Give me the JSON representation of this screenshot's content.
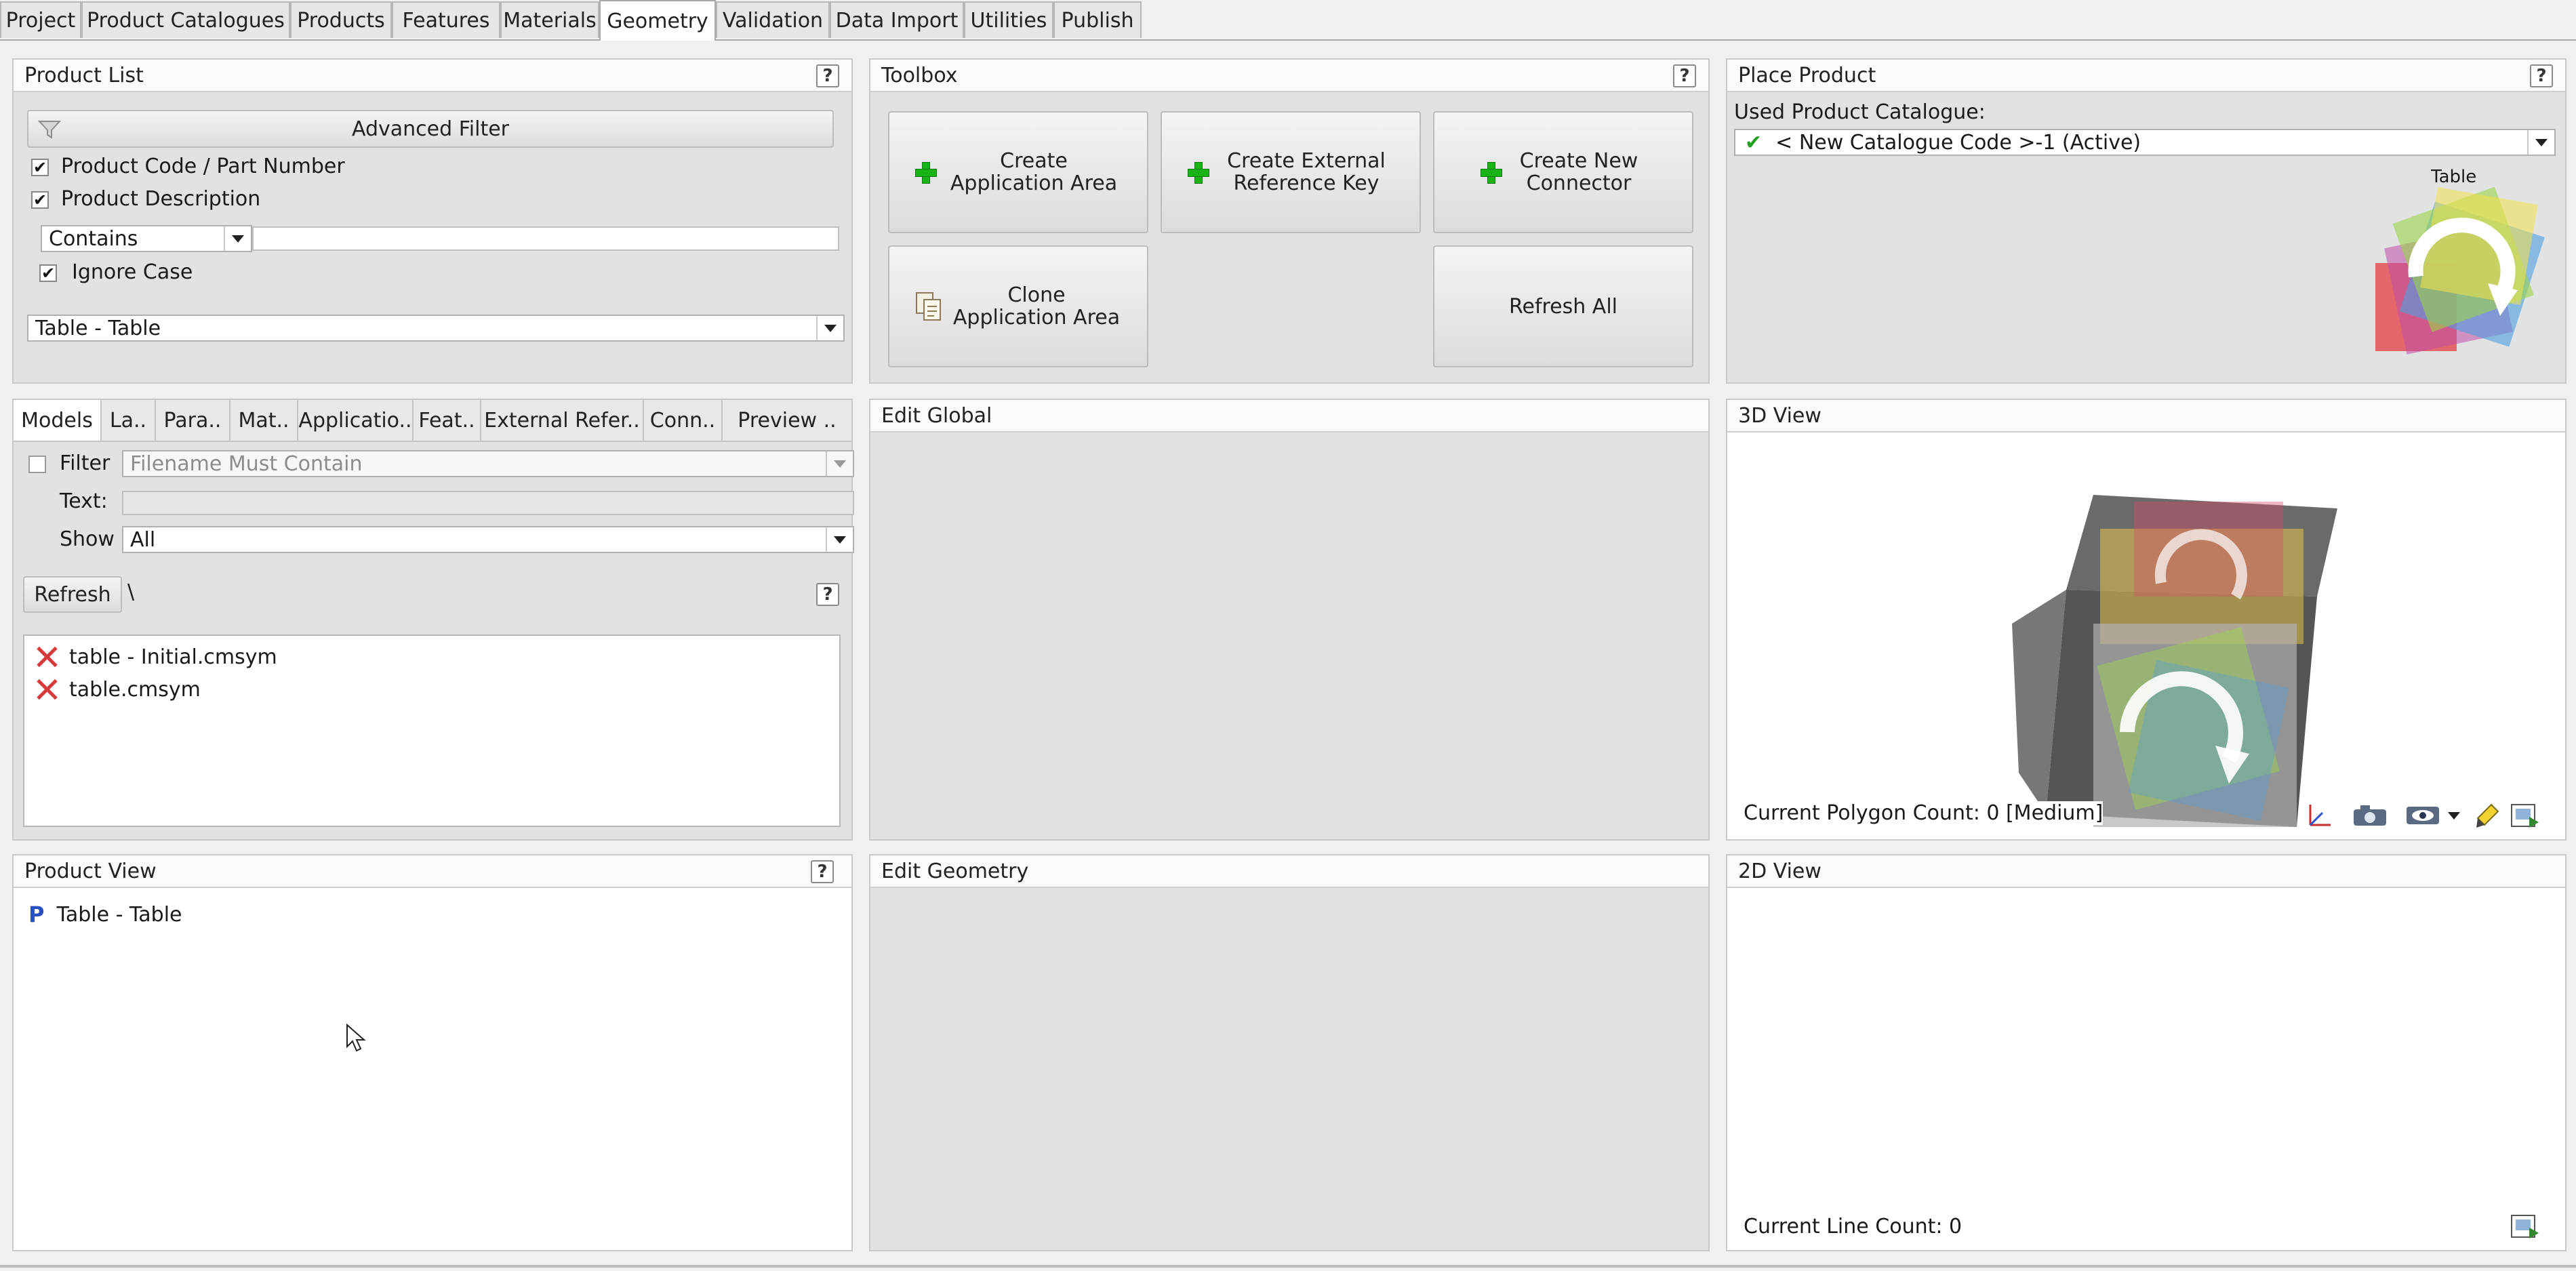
{
  "tabs": [
    {
      "label": "Project",
      "active": false
    },
    {
      "label": "Product Catalogues",
      "active": false
    },
    {
      "label": "Products",
      "active": false
    },
    {
      "label": "Features",
      "active": false
    },
    {
      "label": "Materials",
      "active": false
    },
    {
      "label": "Geometry",
      "active": true
    },
    {
      "label": "Validation",
      "active": false
    },
    {
      "label": "Data Import",
      "active": false
    },
    {
      "label": "Utilities",
      "active": false
    },
    {
      "label": "Publish",
      "active": false
    }
  ],
  "product_list": {
    "title": "Product List",
    "help": "?",
    "advanced_filter": "Advanced Filter",
    "checks": [
      {
        "label": "Product Code / Part Number",
        "checked": true
      },
      {
        "label": "Product Description",
        "checked": true
      }
    ],
    "match_mode": "Contains",
    "search_value": "",
    "ignore_case": {
      "label": "Ignore Case",
      "checked": true
    },
    "product_select": "Table - Table"
  },
  "toolbox": {
    "title": "Toolbox",
    "help": "?",
    "buttons": {
      "create_app_area": "Create Application Area",
      "create_ext_ref": "Create External Reference Key",
      "create_connector": "Create New Connector",
      "clone_app_area": "Clone Application Area",
      "refresh_all": "Refresh All"
    }
  },
  "place_product": {
    "title": "Place Product",
    "help": "?",
    "used_catalogue_label": "Used Product Catalogue:",
    "catalogue_value": "< New Catalogue Code >-1 (Active)",
    "thumbnail_label": "Table"
  },
  "models": {
    "subtabs": [
      "Models",
      "La..",
      "Para..",
      "Mat..",
      "Applicatio..",
      "Feat..",
      "External Refer..",
      "Conn..",
      "Preview .."
    ],
    "filter_label": "Filter",
    "filter_checked": false,
    "filter_placeholder": "Filename Must Contain",
    "text_label": "Text:",
    "show_label": "Show",
    "show_value": "All",
    "refresh": "Refresh",
    "path": "\\",
    "help": "?",
    "files": [
      "table - Initial.cmsym",
      "table.cmsym"
    ]
  },
  "edit_global": {
    "title": "Edit Global"
  },
  "view3d": {
    "title": "3D View",
    "polygon_count": "Current Polygon Count: 0 [Medium]",
    "toolbar_icons": [
      "axes-icon",
      "camera-icon",
      "eye-icon",
      "dropdown-arrow-icon",
      "highlighter-icon",
      "export-image-icon"
    ]
  },
  "product_view": {
    "title": "Product View",
    "help": "?",
    "node_icon": "P",
    "node_label": "Table - Table"
  },
  "edit_geometry": {
    "title": "Edit Geometry"
  },
  "view2d": {
    "title": "2D View",
    "line_count": "Current Line Count: 0"
  },
  "colors": {
    "panel_bg": "#e1e2e2",
    "header_bg": "#fafafa",
    "accent_green": "#17b317",
    "error_red": "#d63a3a",
    "product_blue": "#2a4fbf"
  }
}
